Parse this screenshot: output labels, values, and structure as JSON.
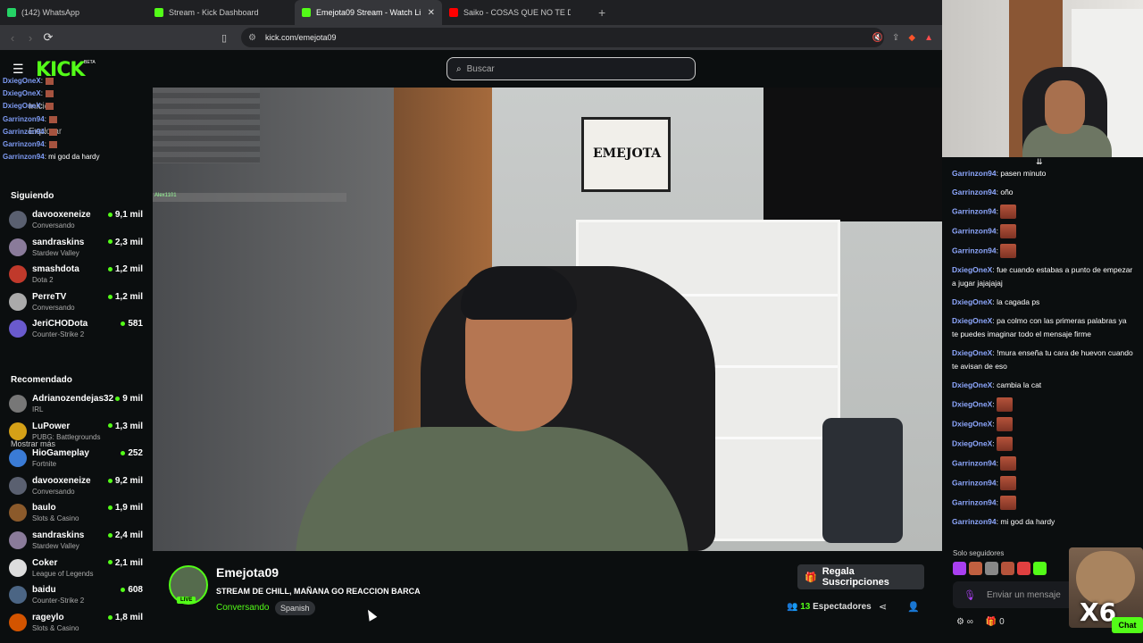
{
  "browser": {
    "tabs": [
      {
        "label": "(142) WhatsApp",
        "color": "#25d366",
        "active": false
      },
      {
        "label": "Stream - Kick Dashboard",
        "color": "#53fc18",
        "active": false
      },
      {
        "label": "Emejota09 Stream - Watch Li",
        "color": "#53fc18",
        "active": true
      },
      {
        "label": "Saiko - COSAS QUE NO TE DIJE (Offi",
        "color": "#ff0000",
        "active": false
      }
    ],
    "url": "kick.com/emejota09"
  },
  "header": {
    "logo": "KICK",
    "beta": "BETA",
    "search_placeholder": "Buscar"
  },
  "overlay_chat": [
    {
      "user": "DxiegOneX",
      "text": ":",
      "emote": true
    },
    {
      "user": "DxiegOneX",
      "text": ":",
      "emote": true
    },
    {
      "user": "DxiegOneX",
      "text": ":",
      "emote": true
    },
    {
      "user": "Garrinzon94",
      "text": ":",
      "emote": true
    },
    {
      "user": "Garrinzon94",
      "text": ":",
      "emote": true
    },
    {
      "user": "Garrinzon94",
      "text": ":",
      "emote": true
    },
    {
      "user": "Garrinzon94",
      "text": ": mi god da hardy",
      "emote": false
    }
  ],
  "sidebar": {
    "ghost_inicio": "Inicio",
    "ghost_explorar": "Explorar",
    "following_title": "Siguiendo",
    "following": [
      {
        "name": "davooxeneize",
        "category": "Conversando",
        "viewers": "9,1 mil",
        "color": "#5a6070"
      },
      {
        "name": "sandraskins",
        "category": "Stardew Valley",
        "viewers": "2,3 mil",
        "color": "#8a7b9a"
      },
      {
        "name": "smashdota",
        "category": "Dota 2",
        "viewers": "1,2 mil",
        "color": "#c0392b"
      },
      {
        "name": "PerreTV",
        "category": "Conversando",
        "viewers": "1,2 mil",
        "color": "#aaa"
      },
      {
        "name": "JeriCHODota",
        "category": "Counter-Strike 2",
        "viewers": "581",
        "color": "#6a5acd"
      }
    ],
    "show_more": "Mostrar más",
    "recommended_title": "Recomendado",
    "recommended": [
      {
        "name": "Adrianozendejas32",
        "category": "IRL",
        "viewers": "9 mil",
        "color": "#777"
      },
      {
        "name": "LuPower",
        "category": "PUBG: Battlegrounds",
        "viewers": "1,3 mil",
        "color": "#d4a017"
      },
      {
        "name": "HioGameplay",
        "category": "Fortnite",
        "viewers": "252",
        "color": "#3a7bd5"
      },
      {
        "name": "davooxeneize",
        "category": "Conversando",
        "viewers": "9,2 mil",
        "color": "#5a6070"
      },
      {
        "name": "baulo",
        "category": "Slots & Casino",
        "viewers": "1,9 mil",
        "color": "#8b5a2b"
      },
      {
        "name": "sandraskins",
        "category": "Stardew Valley",
        "viewers": "2,4 mil",
        "color": "#8a7b9a"
      },
      {
        "name": "Coker",
        "category": "League of Legends",
        "viewers": "2,1 mil",
        "color": "#ddd"
      },
      {
        "name": "baidu",
        "category": "Counter-Strike 2",
        "viewers": "608",
        "color": "#4b6584"
      },
      {
        "name": "rageylo",
        "category": "Slots & Casino",
        "viewers": "1,8 mil",
        "color": "#d35400"
      }
    ]
  },
  "video": {
    "poster_text": "EMEJOTA",
    "alex_tag": "Alex1101"
  },
  "stream": {
    "name": "Emejota09",
    "live": "LIVE",
    "title": "STREAM DE CHILL, MAÑANA GO REACCION BARCA",
    "category": "Conversando",
    "language": "Spanish",
    "gift_label": "Regala Suscripciones",
    "viewers": "13",
    "viewers_label": "Espectadores"
  },
  "chat": {
    "messages": [
      {
        "user": "Garrinzon94",
        "text": "pasen minuto",
        "emote": false
      },
      {
        "user": "Garrinzon94",
        "text": "oño",
        "emote": false
      },
      {
        "user": "Garrinzon94",
        "text": "",
        "emote": true
      },
      {
        "user": "Garrinzon94",
        "text": "",
        "emote": true
      },
      {
        "user": "Garrinzon94",
        "text": "",
        "emote": true
      },
      {
        "user": "DxiegOneX",
        "text": "fue cuando estabas a punto de empezar a jugar jajajajaj",
        "emote": false
      },
      {
        "user": "DxiegOneX",
        "text": "la cagada ps",
        "emote": false
      },
      {
        "user": "DxiegOneX",
        "text": "pa colmo con las primeras palabras ya te puedes imaginar todo el mensaje firme",
        "emote": false
      },
      {
        "user": "DxiegOneX",
        "text": "!mura enseña tu cara de huevon cuando te avisan de eso",
        "emote": false
      },
      {
        "user": "DxiegOneX",
        "text": "cambia la cat",
        "emote": false
      },
      {
        "user": "DxiegOneX",
        "text": "",
        "emote": true
      },
      {
        "user": "DxiegOneX",
        "text": "",
        "emote": true
      },
      {
        "user": "DxiegOneX",
        "text": "",
        "emote": true
      },
      {
        "user": "Garrinzon94",
        "text": "",
        "emote": true
      },
      {
        "user": "Garrinzon94",
        "text": "",
        "emote": true
      },
      {
        "user": "Garrinzon94",
        "text": "",
        "emote": true
      },
      {
        "user": "Garrinzon94",
        "text": "mi god da hardy",
        "emote": false
      }
    ],
    "followers_only": "Solo seguidores",
    "input_placeholder": "Enviar un mensaje",
    "points": "0",
    "chat_button": "Chat",
    "reaction_count": "X6"
  }
}
